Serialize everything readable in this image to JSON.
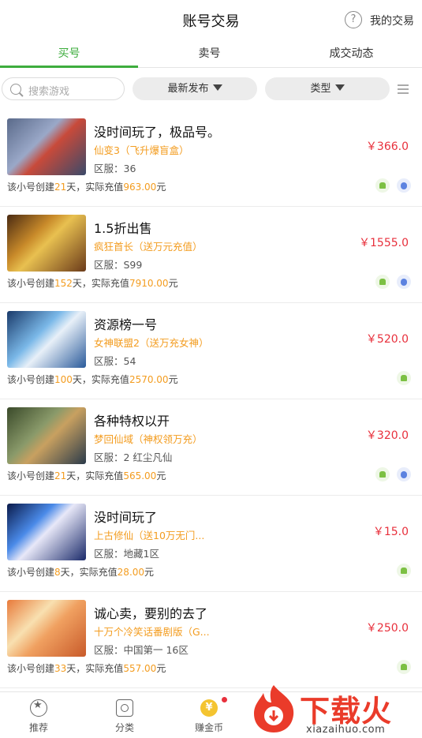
{
  "header": {
    "title": "账号交易",
    "help_glyph": "?",
    "my_trades": "我的交易"
  },
  "tabs": [
    {
      "label": "买号",
      "active": true
    },
    {
      "label": "卖号",
      "active": false
    },
    {
      "label": "成交动态",
      "active": false
    }
  ],
  "filters": {
    "search_placeholder": "搜索游戏",
    "sort_label": "最新发布",
    "type_label": "类型",
    "list_icon": "list-icon"
  },
  "listings": [
    {
      "title": "没时间玩了，极品号。",
      "game": "仙变3（飞升爆盲盒）",
      "server": "区服：36",
      "price": "￥366.0",
      "stats": {
        "prefix": "该小号创建",
        "days": "21",
        "mid": "天，实际充值",
        "amount": "963.00",
        "suffix": "元"
      },
      "platforms": [
        "android",
        "ios"
      ]
    },
    {
      "title": "1.5折出售",
      "game": "疯狂首长（送万元充值）",
      "server": "区服：S99",
      "price": "￥1555.0",
      "stats": {
        "prefix": "该小号创建",
        "days": "152",
        "mid": "天，实际充值",
        "amount": "7910.00",
        "suffix": "元"
      },
      "platforms": [
        "android",
        "ios"
      ]
    },
    {
      "title": "资源榜一号",
      "game": "女神联盟2（送万充女神）",
      "server": "区服：54",
      "price": "￥520.0",
      "stats": {
        "prefix": "该小号创建",
        "days": "100",
        "mid": "天，实际充值",
        "amount": "2570.00",
        "suffix": "元"
      },
      "platforms": [
        "android"
      ]
    },
    {
      "title": "各种特权以开",
      "game": "梦回仙域（神权领万充）",
      "server": "区服：2 红尘凡仙",
      "price": "￥320.0",
      "stats": {
        "prefix": "该小号创建",
        "days": "21",
        "mid": "天，实际充值",
        "amount": "565.00",
        "suffix": "元"
      },
      "platforms": [
        "android",
        "ios"
      ]
    },
    {
      "title": "没时间玩了",
      "game": "上古修仙（送10万无门...",
      "server": "区服：地藏1区",
      "price": "￥15.0",
      "stats": {
        "prefix": "该小号创建",
        "days": "8",
        "mid": "天，实际充值",
        "amount": "28.00",
        "suffix": "元"
      },
      "platforms": [
        "android"
      ]
    },
    {
      "title": "诚心卖，要别的去了",
      "game": "十万个冷笑话番剧版（G...",
      "server": "区服：中国第一 16区",
      "price": "￥250.0",
      "stats": {
        "prefix": "该小号创建",
        "days": "33",
        "mid": "天，实际充值",
        "amount": "557.00",
        "suffix": "元"
      },
      "platforms": [
        "android"
      ]
    }
  ],
  "bottom_nav": [
    {
      "label": "推荐",
      "icon": "star-circle-icon"
    },
    {
      "label": "分类",
      "icon": "category-icon"
    },
    {
      "label": "赚金币",
      "icon": "coin-icon",
      "glyph": "¥",
      "badge": true
    }
  ],
  "watermark": {
    "brand": "下载火",
    "url": "xiazaihuo.com"
  },
  "colors": {
    "accent": "#3dad3d",
    "price": "#e8303c",
    "highlight": "#f39c1f"
  }
}
